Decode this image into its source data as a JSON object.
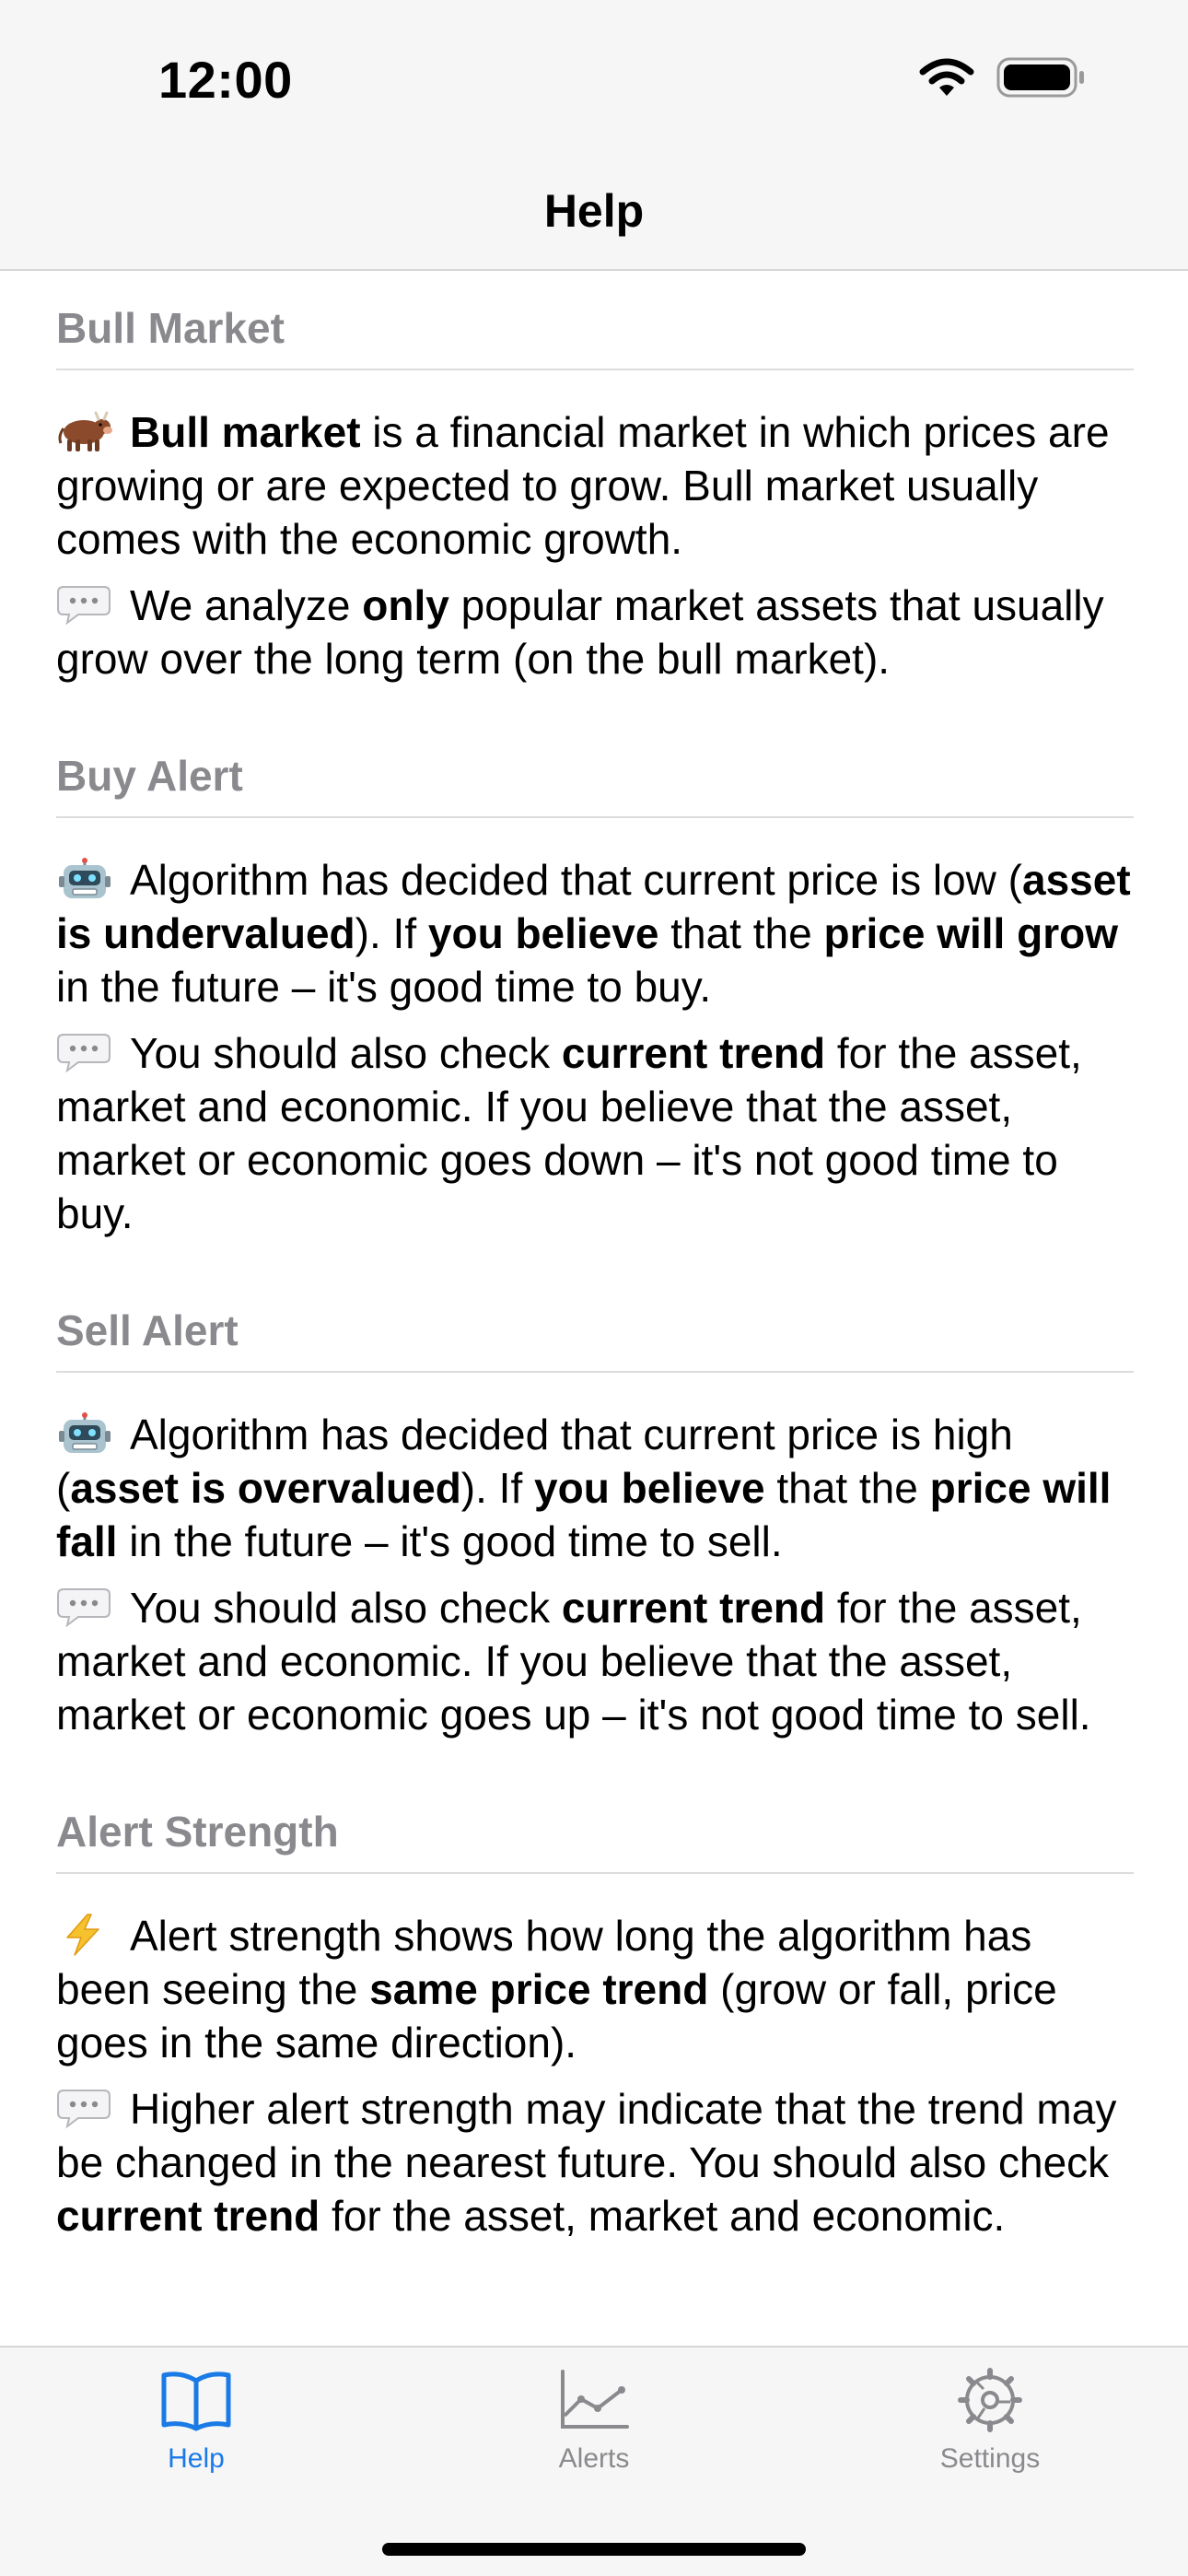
{
  "status": {
    "time": "12:00"
  },
  "nav": {
    "title": "Help"
  },
  "sections": [
    {
      "title": "Bull Market",
      "paragraphs": [
        {
          "icon": "cow-emoji",
          "parts": [
            {
              "b": "Bull market"
            },
            {
              "t": " is a financial market in which prices are growing or are expected to grow. Bull market usually comes with the economic growth."
            }
          ]
        },
        {
          "icon": "speech-bubble-emoji",
          "parts": [
            {
              "t": "We analyze "
            },
            {
              "b": "only"
            },
            {
              "t": " popular market assets that usually grow over the long term (on the bull market)."
            }
          ]
        }
      ]
    },
    {
      "title": "Buy Alert",
      "paragraphs": [
        {
          "icon": "robot-emoji",
          "parts": [
            {
              "t": "Algorithm has decided that current price is low ("
            },
            {
              "b": "asset is undervalued"
            },
            {
              "t": "). If "
            },
            {
              "b": "you believe"
            },
            {
              "t": " that the "
            },
            {
              "b": "price will grow"
            },
            {
              "t": " in the future – it's good time to buy."
            }
          ]
        },
        {
          "icon": "speech-bubble-emoji",
          "parts": [
            {
              "t": "You should also check "
            },
            {
              "b": "current trend"
            },
            {
              "t": " for the asset, market and economic. If you believe that the asset, market or economic goes down – it's not good time to buy."
            }
          ]
        }
      ]
    },
    {
      "title": "Sell Alert",
      "paragraphs": [
        {
          "icon": "robot-emoji",
          "parts": [
            {
              "t": "Algorithm has decided that current price is high ("
            },
            {
              "b": "asset is overvalued"
            },
            {
              "t": "). If "
            },
            {
              "b": "you believe"
            },
            {
              "t": " that the "
            },
            {
              "b": "price will fall"
            },
            {
              "t": " in the future – it's good time to sell."
            }
          ]
        },
        {
          "icon": "speech-bubble-emoji",
          "parts": [
            {
              "t": "You should also check "
            },
            {
              "b": "current trend"
            },
            {
              "t": " for the asset, market and economic. If you believe that the asset, market or economic goes up – it's not good time to sell."
            }
          ]
        }
      ]
    },
    {
      "title": "Alert Strength",
      "paragraphs": [
        {
          "icon": "lightning-emoji",
          "parts": [
            {
              "t": "Alert strength shows how long the algorithm has been seeing the "
            },
            {
              "b": "same price trend"
            },
            {
              "t": " (grow or fall, price goes in the same direction)."
            }
          ]
        },
        {
          "icon": "speech-bubble-emoji",
          "parts": [
            {
              "t": "Higher alert strength may indicate that the trend may be changed in the nearest future. You should also check "
            },
            {
              "b": "current trend"
            },
            {
              "t": " for the asset, market and economic."
            }
          ]
        }
      ]
    }
  ],
  "tabs": [
    {
      "label": "Help",
      "icon": "book-icon",
      "active": true
    },
    {
      "label": "Alerts",
      "icon": "chart-icon",
      "active": false
    },
    {
      "label": "Settings",
      "icon": "gear-icon",
      "active": false
    }
  ],
  "colors": {
    "accent": "#1a7ae6",
    "secondary_text": "#8a8a8e",
    "bar_background": "#f6f6f6"
  }
}
